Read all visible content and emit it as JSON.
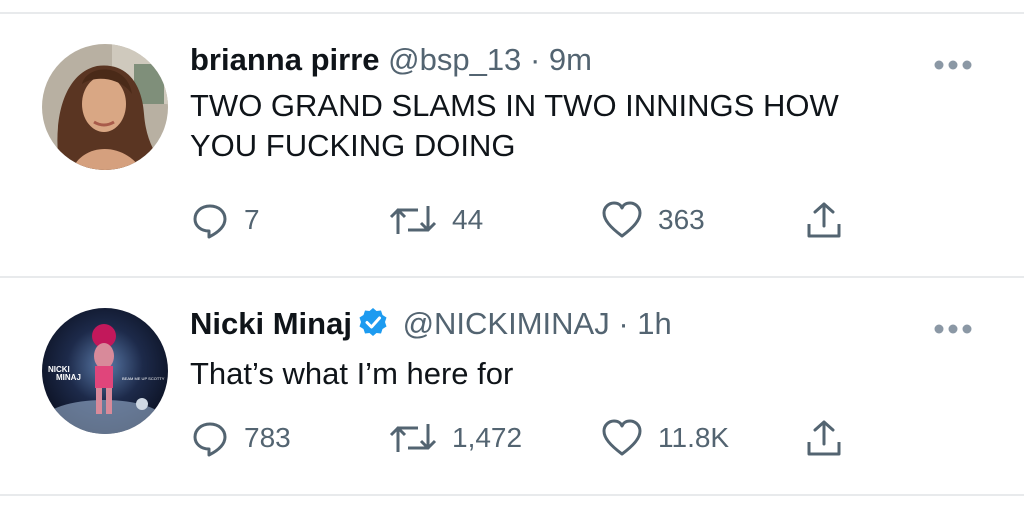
{
  "colors": {
    "text": "#0f1419",
    "secondary": "#536471",
    "divider": "#e8eaec",
    "verified": "#1d9bf0"
  },
  "tweets": [
    {
      "name": "brianna pirre",
      "handle": "@bsp_13",
      "separator": "·",
      "time": "9m",
      "verified": false,
      "text_lines": [
        "TWO GRAND SLAMS IN TWO INNINGS HOW",
        "YOU FUCKING DOING"
      ],
      "replies": "7",
      "retweets": "44",
      "likes": "363",
      "avatar_icon": "profile-photo"
    },
    {
      "name": "Nicki Minaj",
      "handle": "@NICKIMINAJ",
      "separator": "·",
      "time": "1h",
      "verified": true,
      "text_lines": [
        "That’s what I’m here for"
      ],
      "replies": "783",
      "retweets": "1,472",
      "likes": "11.8K",
      "avatar_icon": "album-cover-photo",
      "avatar_text": [
        "NICKI",
        "MINAJ",
        "BEAM ME UP SCOTTY"
      ]
    }
  ],
  "icons": [
    "reply-icon",
    "retweet-icon",
    "like-icon",
    "share-icon",
    "more-icon",
    "verified-badge-icon"
  ]
}
